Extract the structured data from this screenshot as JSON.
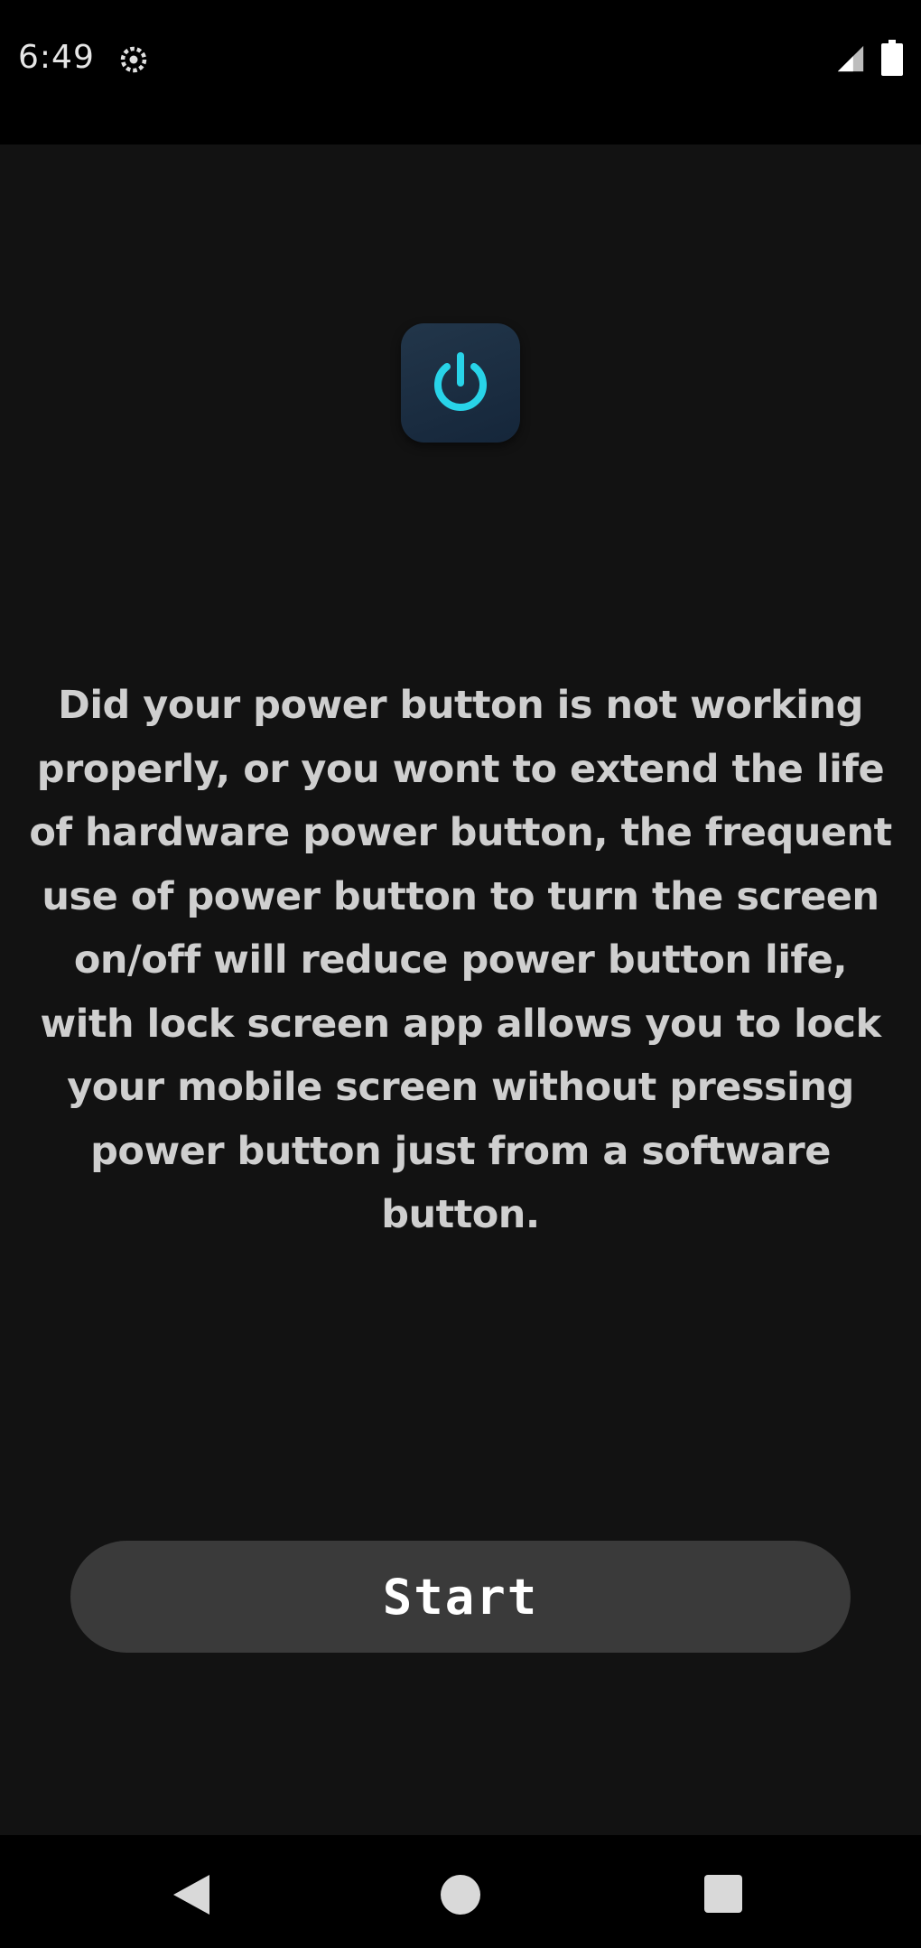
{
  "status_bar": {
    "time": "6:49",
    "icons": [
      "gear-icon",
      "signal-icon",
      "battery-icon"
    ]
  },
  "main": {
    "app_icon": "power-icon",
    "accent_color": "#28d3e8",
    "description": "Did your power button is not working properly, or you wont to extend the life of hardware power button, the frequent use of power button to turn the screen on/off will reduce power button life, with lock screen app allows you to lock your mobile screen without pressing power button just from a software button.",
    "start_button_label": "Start"
  },
  "nav_bar": {
    "icons": [
      "back-icon",
      "home-icon",
      "recents-icon"
    ]
  }
}
